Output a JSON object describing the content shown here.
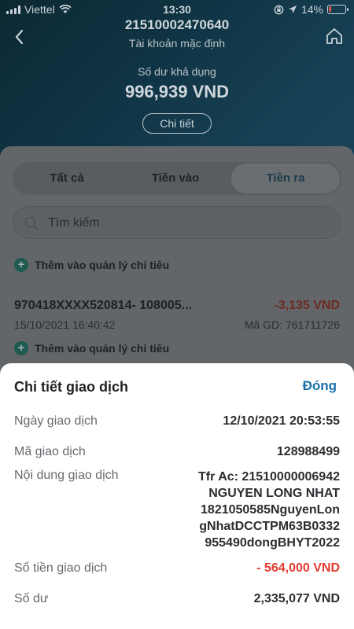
{
  "status_bar": {
    "carrier": "Viettel",
    "time": "13:30",
    "battery": "14%",
    "battery_fraction": 0.14
  },
  "header": {
    "account_number": "21510002470640",
    "account_type": "Tài khoản mặc định",
    "balance_label": "Số dư khả dụng",
    "balance_value": "996,939 VND",
    "detail_button": "Chi tiết"
  },
  "tabs": [
    {
      "label": "Tất cả",
      "active": false
    },
    {
      "label": "Tiền vào",
      "active": false
    },
    {
      "label": "Tiền ra",
      "active": true
    }
  ],
  "search": {
    "placeholder": "Tìm kiếm"
  },
  "add_spending_label": "Thêm vào quản lý chi tiêu",
  "transaction": {
    "description": "970418XXXX520814- 108005...",
    "amount": "-3,135 VND",
    "date": "15/10/2021 16:40:42",
    "code": "Mã GD: 761711726"
  },
  "sheet": {
    "title": "Chi tiết giao dịch",
    "close_label": "Đóng",
    "rows": {
      "date": {
        "label": "Ngày giao dịch",
        "value": "12/10/2021 20:53:55"
      },
      "code": {
        "label": "Mã giao dịch",
        "value": "128988499"
      },
      "content": {
        "label": "Nội dung giao dịch",
        "lines": [
          "Tfr Ac: 21510000006942",
          "NGUYEN LONG NHAT",
          "1821050585NguyenLon",
          "gNhatDCCTPM63B0332",
          "955490dongBHYT2022"
        ]
      },
      "amount": {
        "label": "Số tiền giao dịch",
        "value": "- 564,000 VND"
      },
      "balance": {
        "label": "Số dư",
        "value": "2,335,077 VND"
      }
    }
  },
  "colors": {
    "accent": "#1b6fa8",
    "debit_red": "#e53a2f",
    "header_blue": "#2a7398"
  }
}
